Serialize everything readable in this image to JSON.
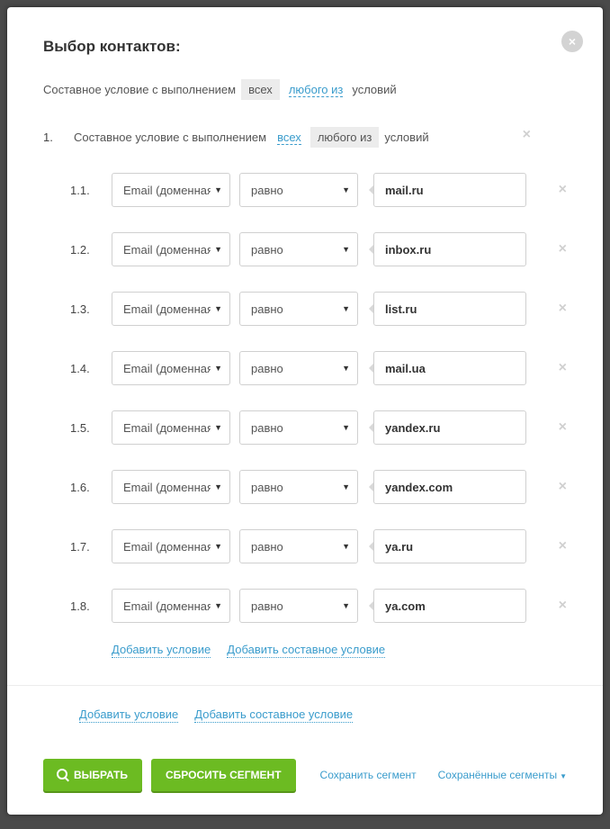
{
  "modal": {
    "title": "Выбор контактов:",
    "close_icon": "×",
    "top_condition": {
      "prefix": "Составное условие с выполнением",
      "all": "всех",
      "any": "любого из",
      "suffix": "условий"
    },
    "group": {
      "number": "1.",
      "prefix": "Составное условие с выполнением",
      "all": "всех",
      "any": "любого из",
      "suffix": "условий",
      "remove_icon": "×"
    },
    "rows": [
      {
        "num": "1.1.",
        "field": "Email (доменная",
        "operator": "равно",
        "value": "mail.ru"
      },
      {
        "num": "1.2.",
        "field": "Email (доменная",
        "operator": "равно",
        "value": "inbox.ru"
      },
      {
        "num": "1.3.",
        "field": "Email (доменная",
        "operator": "равно",
        "value": "list.ru"
      },
      {
        "num": "1.4.",
        "field": "Email (доменная",
        "operator": "равно",
        "value": "mail.ua"
      },
      {
        "num": "1.5.",
        "field": "Email (доменная",
        "operator": "равно",
        "value": "yandex.ru"
      },
      {
        "num": "1.6.",
        "field": "Email (доменная",
        "operator": "равно",
        "value": "yandex.com"
      },
      {
        "num": "1.7.",
        "field": "Email (доменная",
        "operator": "равно",
        "value": "ya.ru"
      },
      {
        "num": "1.8.",
        "field": "Email (доменная",
        "operator": "равно",
        "value": "ya.com"
      }
    ],
    "row_remove_icon": "×",
    "add_condition": "Добавить условие",
    "add_compound": "Добавить составное условие",
    "footer": {
      "select_btn": "ВЫБРАТЬ",
      "reset_btn": "СБРОСИТЬ СЕГМЕНТ",
      "save_segment": "Сохранить сегмент",
      "saved_segments": "Сохранённые сегменты"
    }
  }
}
